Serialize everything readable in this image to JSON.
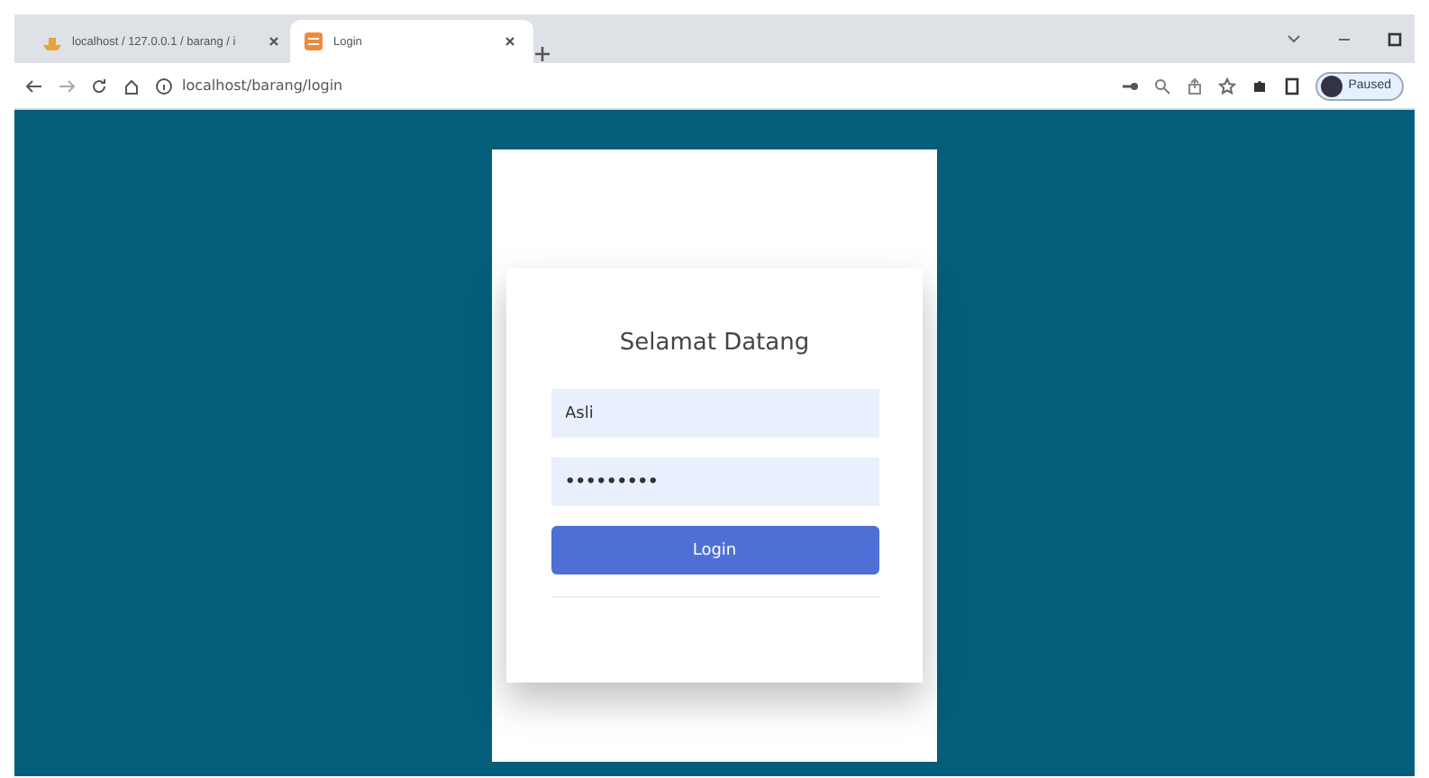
{
  "browser": {
    "tabs": [
      {
        "title": "localhost / 127.0.0.1 / barang / i",
        "selected": false,
        "kind": "db"
      },
      {
        "title": "Login",
        "selected": true,
        "kind": "page"
      }
    ],
    "address": "localhost/barang/login",
    "profile": "Paused"
  },
  "login": {
    "title": "Selamat Datang",
    "fields": [
      {
        "kind": "text",
        "value": "Asli"
      },
      {
        "kind": "password",
        "value": "•••••••••"
      }
    ],
    "button": "Login"
  }
}
